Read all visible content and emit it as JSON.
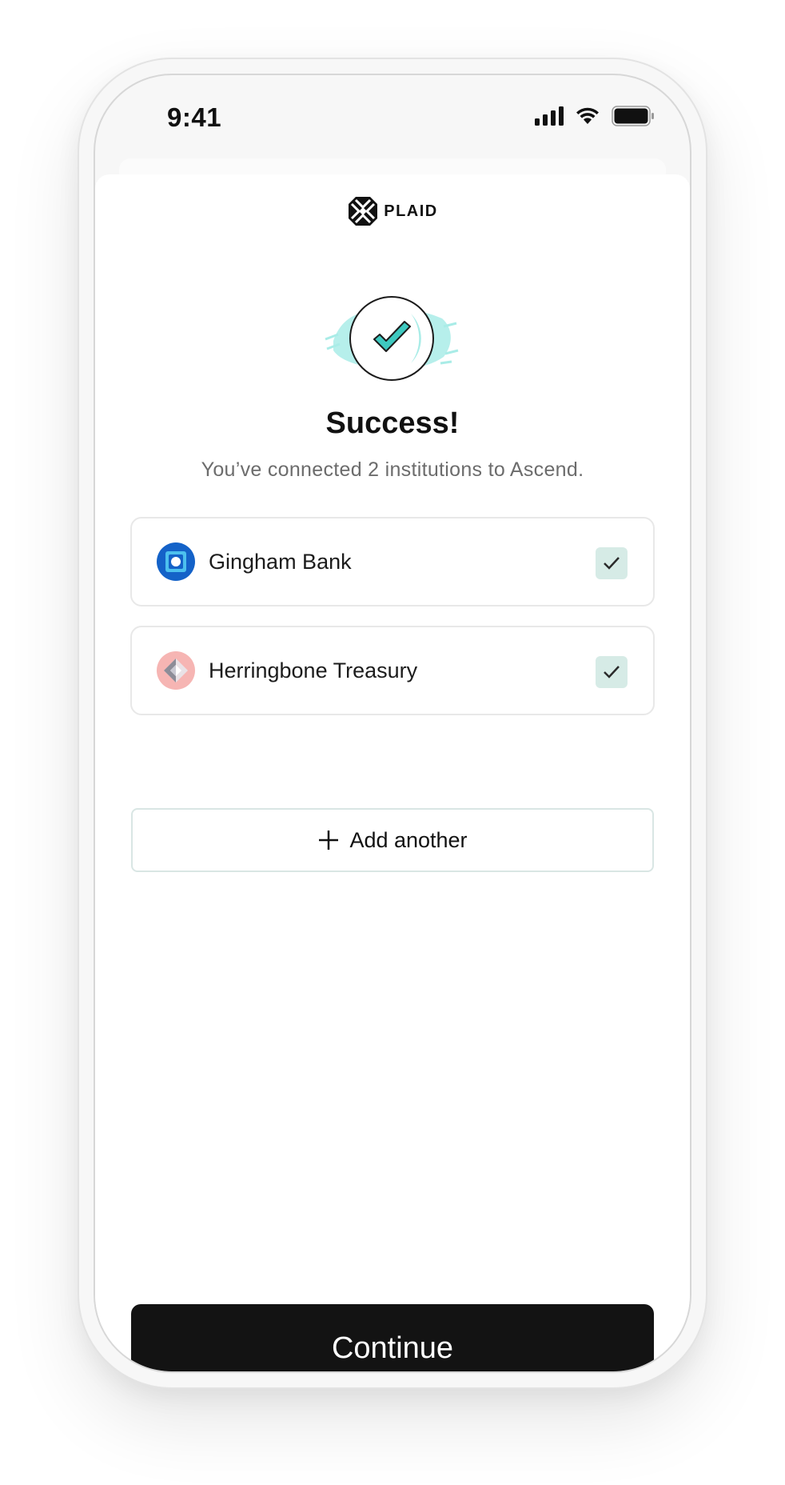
{
  "status_bar": {
    "time": "9:41",
    "icons": [
      "signal-icon",
      "wifi-icon",
      "battery-icon"
    ]
  },
  "header": {
    "brand": "PLAID",
    "logo_icon": "plaid-logo-icon"
  },
  "main": {
    "illustration_icon": "success-checkmark-icon",
    "title": "Success!",
    "subtitle": "You’ve connected 2 institutions to Ascend.",
    "institutions": [
      {
        "name": "Gingham Bank",
        "icon": "gingham-bank-logo",
        "connected": true,
        "color": "#1462c8"
      },
      {
        "name": "Herringbone Treasury",
        "icon": "herringbone-treasury-logo",
        "connected": true,
        "color": "#f6b5b3"
      }
    ],
    "add_button_label": "Add another",
    "add_button_icon": "plus-icon"
  },
  "footer": {
    "continue_label": "Continue"
  },
  "colors": {
    "primary_button": "#131313",
    "check_badge": "#d6ebe6",
    "accent_teal": "#3ec9c0"
  }
}
